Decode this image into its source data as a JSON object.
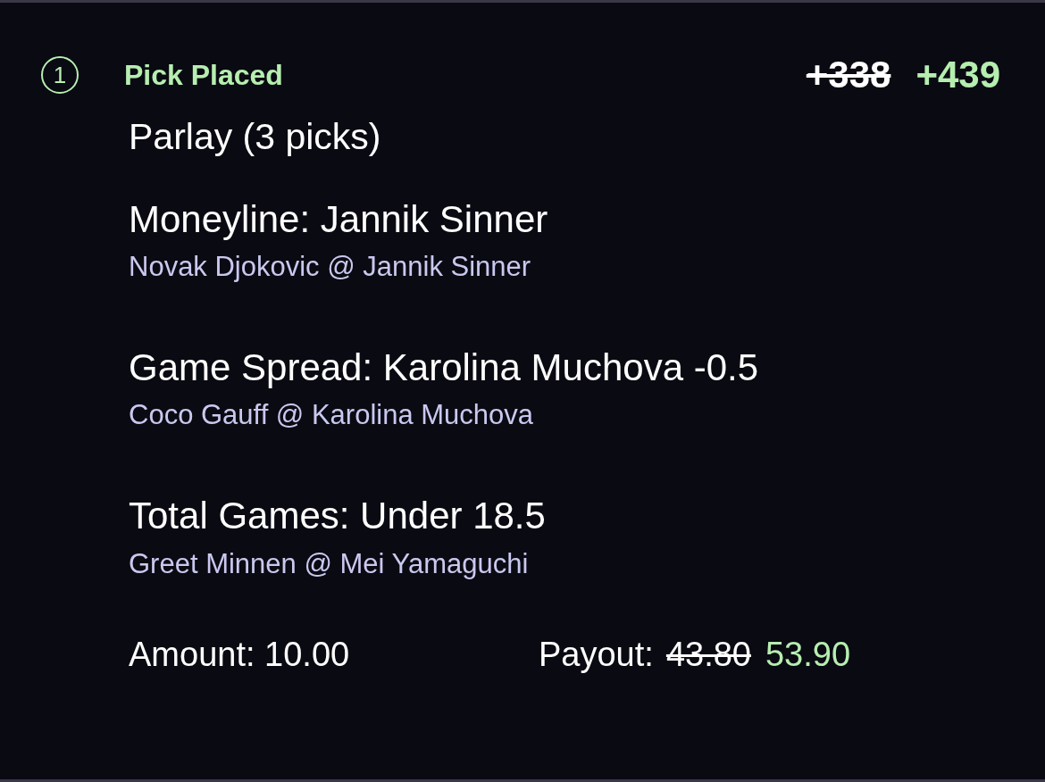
{
  "header": {
    "step": "1",
    "status": "Pick Placed",
    "old_odds": "+338",
    "odds": "+439"
  },
  "title": "Parlay (3 picks)",
  "picks": [
    {
      "market": "Moneyline: Jannik Sinner",
      "matchup": "Novak Djokovic @ Jannik Sinner"
    },
    {
      "market": "Game Spread: Karolina Muchova -0.5",
      "matchup": "Coco Gauff @ Karolina Muchova"
    },
    {
      "market": "Total Games: Under 18.5",
      "matchup": "Greet Minnen @ Mei Yamaguchi"
    }
  ],
  "footer": {
    "amount": "Amount: 10.00",
    "payout_label": "Payout:",
    "old_payout": "43.80",
    "payout": "53.90"
  }
}
